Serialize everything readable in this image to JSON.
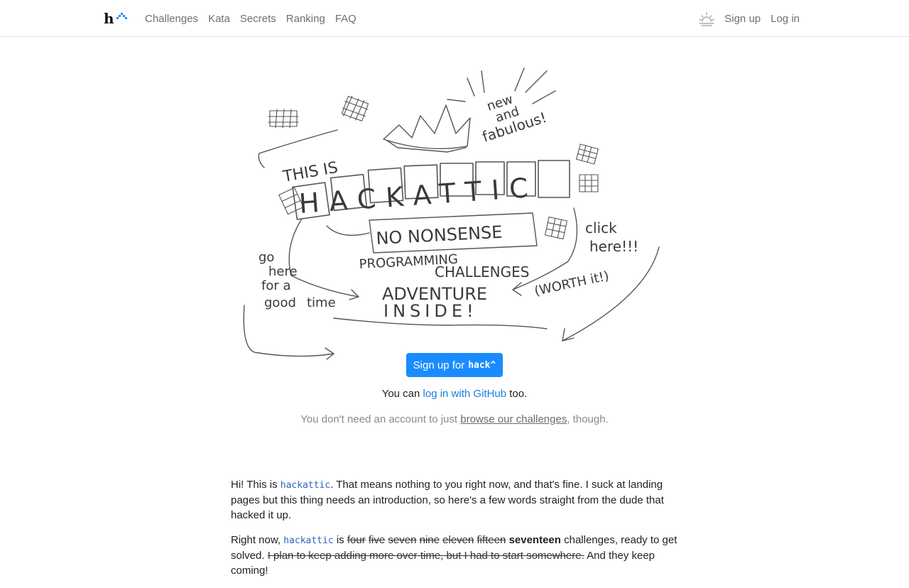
{
  "nav": {
    "logo_label": "hackattic",
    "links": [
      "Challenges",
      "Kata",
      "Secrets",
      "Ranking",
      "FAQ"
    ],
    "theme_icon": "sun-icon",
    "signup": "Sign up",
    "login": "Log in"
  },
  "hero": {
    "alt": "This is hackattic - no nonsense programming challenges - adventure inside! (hand drawn sketch)",
    "sketch_text": {
      "this_is": "THIS IS",
      "title": "HACKATTIC",
      "subtitle": "NO NONSENSE",
      "line2": "PROGRAMMING",
      "line3": "CHALLENGES",
      "line4": "ADVENTURE",
      "line5": "INSIDE!",
      "new_1": "new",
      "new_2": "and",
      "new_3": "fabulous!",
      "click_1": "click",
      "click_2": "here!!!",
      "worth": "(WORTH  it!)",
      "go_1": "go",
      "go_2": "here",
      "go_3": "for a",
      "go_4": "good",
      "go_5": "time"
    }
  },
  "cta": {
    "button_text": "Sign up for",
    "button_mono": "hack^",
    "github_prefix": "You can",
    "github_link": "log in with GitHub",
    "github_suffix": "too.",
    "browse_prefix": "You don't need an account to just",
    "browse_link": "browse our challenges",
    "browse_suffix": ", though."
  },
  "intro": {
    "p1_a": "Hi! This is",
    "p1_code": "hackattic",
    "p1_b": ". That means nothing to you right now, and that's fine. I suck at landing pages but this thing needs an introduction, so here's a few words straight from the dude that hacked it up.",
    "p2_a": "Right now,",
    "p2_code": "hackattic",
    "p2_b": "is",
    "p2_struck": [
      "four",
      "five",
      "seven",
      "nine",
      "eleven",
      "fifteen"
    ],
    "p2_count": "seventeen",
    "p2_c": "challenges, ready to get solved.",
    "p2_struck_sentence": "I plan to keep adding more over time, but I had to start somewhere.",
    "p2_d": "And they keep coming!"
  }
}
